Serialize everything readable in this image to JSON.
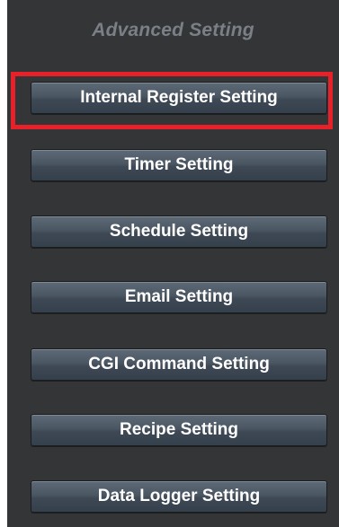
{
  "panel": {
    "title": "Advanced Setting",
    "buttons": [
      {
        "label": "Internal Register Setting",
        "highlighted": true
      },
      {
        "label": "Timer Setting",
        "highlighted": false
      },
      {
        "label": "Schedule Setting",
        "highlighted": false
      },
      {
        "label": "Email Setting",
        "highlighted": false
      },
      {
        "label": "CGI Command Setting",
        "highlighted": false
      },
      {
        "label": "Recipe Setting",
        "highlighted": false
      },
      {
        "label": "Data Logger Setting",
        "highlighted": false
      }
    ]
  },
  "colors": {
    "panel_background": "#333537",
    "title_text": "#7b7f86",
    "button_text": "#ffffff",
    "highlight_border": "#e8202a"
  }
}
